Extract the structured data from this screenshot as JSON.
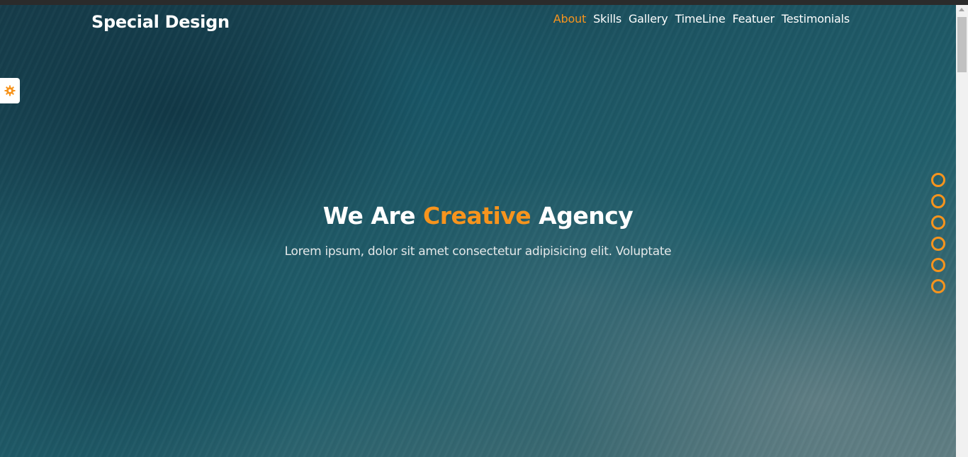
{
  "header": {
    "logo": "Special Design",
    "nav": [
      {
        "label": "About",
        "active": true
      },
      {
        "label": "Skills",
        "active": false
      },
      {
        "label": "Gallery",
        "active": false
      },
      {
        "label": "TimeLine",
        "active": false
      },
      {
        "label": "Featuer",
        "active": false
      },
      {
        "label": "Testimonials",
        "active": false
      }
    ]
  },
  "settings": {
    "icon": "gear-icon"
  },
  "hero": {
    "title_before": "We Are",
    "title_accent": "Creative",
    "title_after": "Agency",
    "subtitle": "Lorem ipsum, dolor sit amet consectetur adipisicing elit. Voluptate"
  },
  "bullets": {
    "count": 6
  },
  "colors": {
    "accent": "#f7941d",
    "text": "#ffffff"
  }
}
